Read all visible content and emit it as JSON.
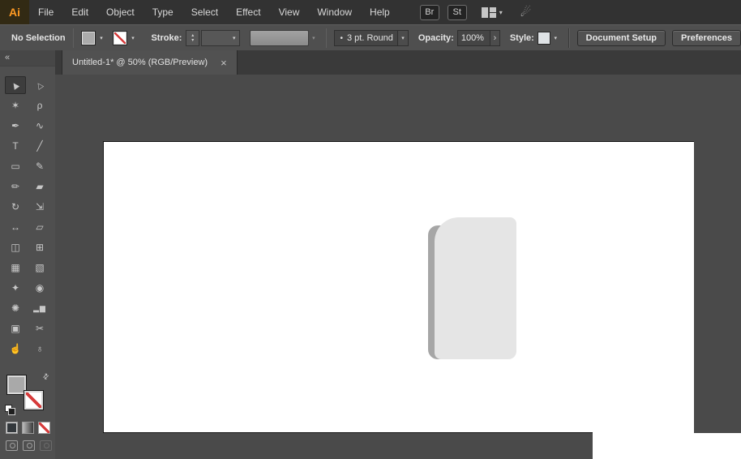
{
  "app": {
    "logo_label": "Ai"
  },
  "menu_bar": {
    "items": [
      "File",
      "Edit",
      "Object",
      "Type",
      "Select",
      "Effect",
      "View",
      "Window",
      "Help"
    ],
    "bridge_label": "Br",
    "stock_label": "St"
  },
  "control_bar": {
    "selection_status": "No Selection",
    "stroke_label": "Stroke:",
    "brush_preset": "3 pt. Round",
    "opacity_label": "Opacity:",
    "opacity_value": "100%",
    "style_label": "Style:",
    "document_setup_label": "Document Setup",
    "preferences_label": "Preferences"
  },
  "document_tab": {
    "title": "Untitled-1* @ 50% (RGB/Preview)",
    "close_glyph": "×"
  },
  "glyphs": {
    "caret_down": "▾",
    "caret_up": "▴",
    "chevron_right": "›",
    "bullet": "•",
    "collapse": "«",
    "swap": "⇄",
    "gpu": "☄"
  },
  "toolbar": {
    "tools": [
      {
        "name": "selection-tool",
        "glyph": "▶",
        "selected": true
      },
      {
        "name": "direct-selection-tool",
        "glyph": "▷"
      },
      {
        "name": "magic-wand-tool",
        "glyph": "✶"
      },
      {
        "name": "lasso-tool",
        "glyph": "ρ"
      },
      {
        "name": "pen-tool",
        "glyph": "✒"
      },
      {
        "name": "curvature-tool",
        "glyph": "∿"
      },
      {
        "name": "type-tool",
        "glyph": "T"
      },
      {
        "name": "line-segment-tool",
        "glyph": "╱"
      },
      {
        "name": "rectangle-tool",
        "glyph": "▭"
      },
      {
        "name": "paintbrush-tool",
        "glyph": "✎"
      },
      {
        "name": "shaper-tool",
        "glyph": "✏"
      },
      {
        "name": "eraser-tool",
        "glyph": "▰"
      },
      {
        "name": "rotate-tool",
        "glyph": "↻"
      },
      {
        "name": "scale-tool",
        "glyph": "⇲"
      },
      {
        "name": "width-tool",
        "glyph": "↔"
      },
      {
        "name": "free-transform-tool",
        "glyph": "▱"
      },
      {
        "name": "shape-builder-tool",
        "glyph": "◫"
      },
      {
        "name": "perspective-grid-tool",
        "glyph": "⊞"
      },
      {
        "name": "mesh-tool",
        "glyph": "▦"
      },
      {
        "name": "gradient-tool",
        "glyph": "▧"
      },
      {
        "name": "eyedropper-tool",
        "glyph": "✦"
      },
      {
        "name": "blend-tool",
        "glyph": "◉"
      },
      {
        "name": "symbol-sprayer-tool",
        "glyph": "✺"
      },
      {
        "name": "column-graph-tool",
        "glyph": "▂▆"
      },
      {
        "name": "artboard-tool",
        "glyph": "▣"
      },
      {
        "name": "slice-tool",
        "glyph": "✂"
      },
      {
        "name": "hand-tool",
        "glyph": "☝"
      },
      {
        "name": "zoom-tool",
        "glyph": "♁"
      }
    ]
  },
  "canvas": {
    "zoom_level": "50%",
    "color_mode": "RGB/Preview",
    "artboard_color": "#ffffff",
    "pasteboard_color": "#4a4a4a",
    "shape_body_color": "#e5e5e5",
    "shape_spine_color": "#a6a6a6"
  },
  "colors": {
    "menu_bar_bg": "#323232",
    "panel_bg": "#4f4f4f",
    "logo_orange": "#ff9a23",
    "none_slash_red": "#d63b3b",
    "fill_gray": "#ababab"
  }
}
